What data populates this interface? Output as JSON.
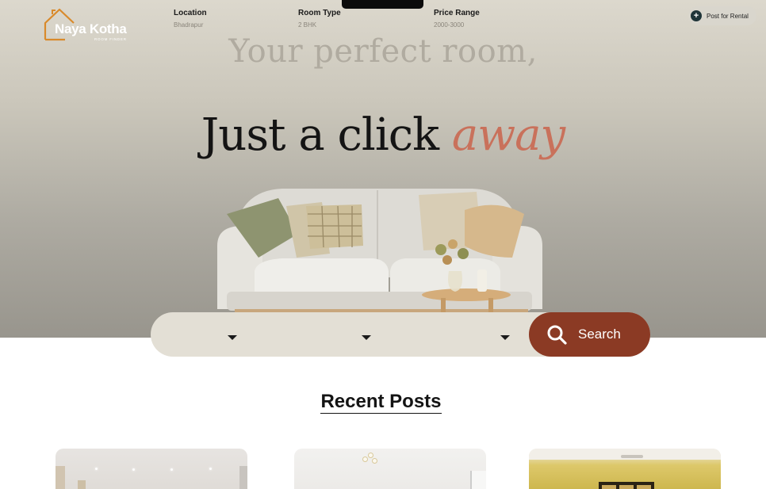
{
  "brand": {
    "name": "Naya Kotha",
    "subtitle": "ROOM FINDER",
    "accent_color": "#d98a2b"
  },
  "header": {
    "post_button_label": "Post for Rental",
    "post_button_icon": "plus-icon"
  },
  "hero": {
    "tagline": "Your perfect room,",
    "headline_main": "Just a click",
    "headline_accent": "away",
    "accent_color": "#c9715b",
    "image": "sofa-image"
  },
  "search": {
    "fields": [
      {
        "label": "Location",
        "value": "Bhadrapur",
        "icon": "caret-down-icon"
      },
      {
        "label": "Room Type",
        "value": "2 BHK",
        "icon": "caret-down-icon"
      },
      {
        "label": "Price Range",
        "value": "2000-3000",
        "icon": "caret-down-icon"
      }
    ],
    "button_label": "Search",
    "button_icon": "search-icon",
    "button_color": "#8b3a24"
  },
  "recent": {
    "title": "Recent Posts",
    "cards": [
      {
        "image": "room-photo-1"
      },
      {
        "image": "room-photo-2"
      },
      {
        "image": "room-photo-3"
      }
    ]
  }
}
